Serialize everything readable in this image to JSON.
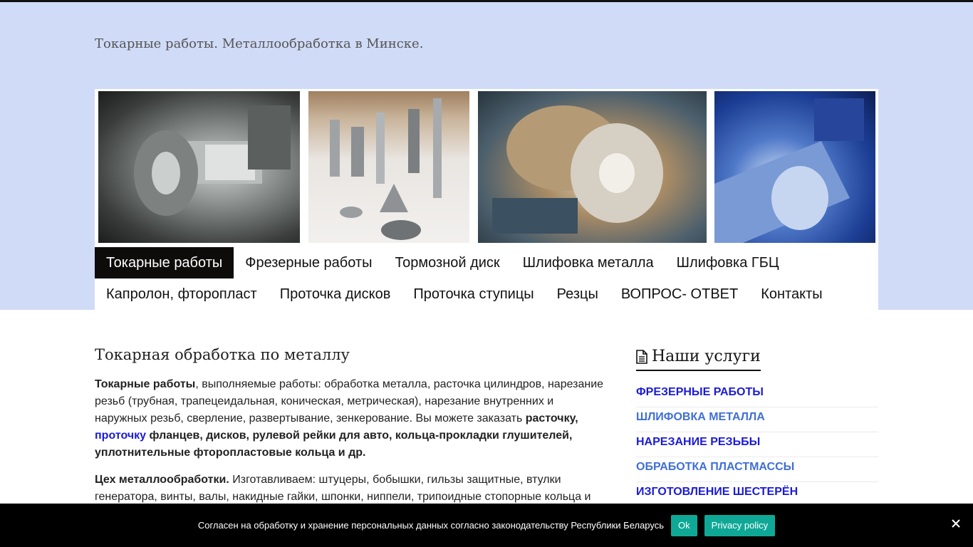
{
  "site": {
    "title": "Токарные работы. Металлообработка в Минске."
  },
  "banner": {
    "photos": [
      "lathe-part-photo",
      "turned-parts-photo",
      "lathe-chuck-photo",
      "cnc-machining-photo"
    ]
  },
  "nav": {
    "row1": [
      "Токарные работы",
      "Фрезерные работы",
      "Тормозной диск",
      "Шлифовка металла",
      "Шлифовка ГБЦ"
    ],
    "row2": [
      "Капролон, фторопласт",
      "Проточка дисков",
      "Проточка ступицы",
      "Резцы",
      "ВОПРОС- ОТВЕТ",
      "Контакты"
    ],
    "active": "Токарные работы"
  },
  "content": {
    "title": "Токарная обработка по металлу",
    "p1_bold1": "Токарные работы",
    "p1_text1": ", выполняемые работы:  обработка металла, расточка цилиндров, нарезание резьб (трубная, трапецеидальная, коническая, метрическая), нарезание внутренних и наружных резьб, сверление, развертывание, зенкерование. Вы можете заказать ",
    "p1_bold2": "расточку,",
    "p1_link": "проточку",
    "p1_bold3": " фланцев, дисков, рулевой рейки для авто, кольца-прокладки глушителей, уплотнительные фторопластовые кольца и др.",
    "p2_bold": "Цех металлообработки.",
    "p2_text": " Изготавливаем:  штуцеры, бобышки, гильзы защитные, втулки генератора, винты, валы, накидные гайки, шпонки, ниппели, трипоидные стопорные кольца и"
  },
  "sidebar": {
    "title": "Наши услуги",
    "services": [
      "ФРЕЗЕРНЫЕ РАБОТЫ",
      "ШЛИФОВКА МЕТАЛЛА",
      "НАРЕЗАНИЕ РЕЗЬБЫ",
      "ОБРАБОТКА ПЛАСТМАССЫ",
      "ИЗГОТОВЛЕНИЕ ШЕСТЕРЁН"
    ]
  },
  "cookie": {
    "text": "Согласен на обработку и хранение персональных данных согласно законодательству Республики Беларусь",
    "ok": "Ok",
    "policy": "Privacy policy"
  },
  "colors": {
    "header_bg": "#d0dbf7",
    "active_nav": "#0e0b0b",
    "link": "#1b1bd6",
    "link_alt": "#3f6fd6",
    "cookie_btn": "#0fa896"
  }
}
